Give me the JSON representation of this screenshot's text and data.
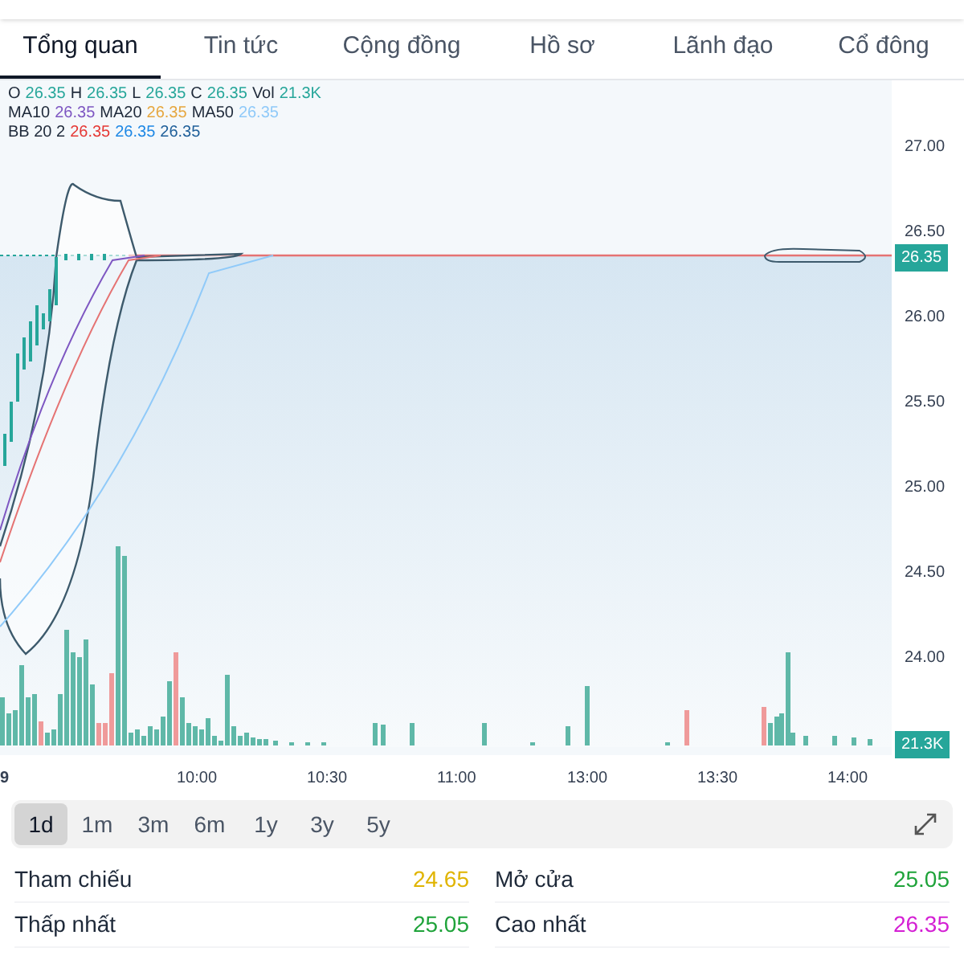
{
  "tabs": [
    {
      "label": "Tổng quan",
      "selected": true
    },
    {
      "label": "Tin tức",
      "selected": false
    },
    {
      "label": "Cộng đồng",
      "selected": false
    },
    {
      "label": "Hồ sơ",
      "selected": false
    },
    {
      "label": "Lãnh đạo",
      "selected": false
    },
    {
      "label": "Cổ đông",
      "selected": false
    }
  ],
  "legend": [
    [
      {
        "label": "O",
        "value": "26.35",
        "color": "#26a69a"
      },
      {
        "label": "H",
        "value": "26.35",
        "color": "#26a69a"
      },
      {
        "label": "L",
        "value": "26.35",
        "color": "#26a69a"
      },
      {
        "label": "C",
        "value": "26.35",
        "color": "#26a69a"
      },
      {
        "label": "Vol",
        "value": "21.3K",
        "color": "#26a69a"
      }
    ],
    [
      {
        "label": "MA10",
        "value": "26.35",
        "color": "#7e57c2"
      },
      {
        "label": "MA20",
        "value": "26.35",
        "color": "#e6a740"
      },
      {
        "label": "MA50",
        "value": "26.35",
        "color": "#90caf9"
      }
    ],
    [
      {
        "label": "BB 20 2",
        "value": "26.35",
        "color": "#e53935"
      },
      {
        "value": "26.35",
        "color": "#1e88e5"
      },
      {
        "value": "26.35",
        "color": "#1f5f99"
      }
    ]
  ],
  "y_axis": [
    "27.00",
    "26.50",
    "26.00",
    "25.50",
    "25.00",
    "24.50",
    "24.00"
  ],
  "price_badge": "26.35",
  "volume_badge": "21.3K",
  "x_axis": [
    "9",
    "10:00",
    "10:30",
    "11:00",
    "13:00",
    "13:30",
    "14:00"
  ],
  "periods": [
    {
      "label": "1d",
      "selected": true
    },
    {
      "label": "1m",
      "selected": false
    },
    {
      "label": "3m",
      "selected": false
    },
    {
      "label": "6m",
      "selected": false
    },
    {
      "label": "1y",
      "selected": false
    },
    {
      "label": "3y",
      "selected": false
    },
    {
      "label": "5y",
      "selected": false
    }
  ],
  "stats": [
    {
      "label": "Tham chiếu",
      "value": "24.65",
      "color": "#e0b400"
    },
    {
      "label": "Mở cửa",
      "value": "25.05",
      "color": "#1fa33a"
    },
    {
      "label": "Thấp nhất",
      "value": "25.05",
      "color": "#1fa33a"
    },
    {
      "label": "Cao nhất",
      "value": "26.35",
      "color": "#d41fd4"
    }
  ]
}
